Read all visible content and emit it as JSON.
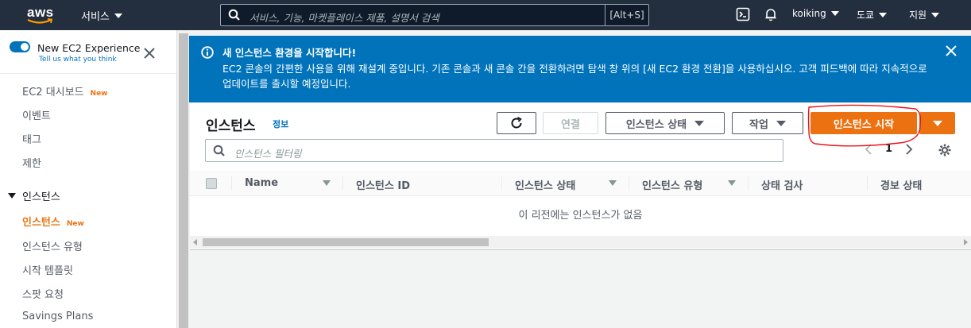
{
  "topnav": {
    "logo_text": "aws",
    "services_label": "서비스",
    "search_placeholder": "서비스, 기능, 마켓플레이스 제품, 설명서 검색",
    "search_shortcut": "[Alt+S]",
    "user": "koiking",
    "region": "도쿄",
    "support": "지원",
    "icons": [
      "terminal-icon",
      "bell-icon"
    ]
  },
  "sidebar": {
    "new_experience": "New EC2 Experience",
    "tell_us": "Tell us what you think",
    "items": [
      {
        "label": "EC2 대시보드",
        "badge": "New"
      },
      {
        "label": "이벤트"
      },
      {
        "label": "태그"
      },
      {
        "label": "제한"
      }
    ],
    "section": "인스턴스",
    "section_items": [
      {
        "label": "인스턴스",
        "badge": "New",
        "active": true
      },
      {
        "label": "인스턴스 유형"
      },
      {
        "label": "시작 템플릿"
      },
      {
        "label": "스팟 요청"
      },
      {
        "label": "Savings Plans"
      }
    ]
  },
  "flash": {
    "title": "새 인스턴스 환경을 시작합니다!",
    "body": "EC2 콘솔의 간편한 사용을 위해 재설계 중입니다. 기존 콘솔과 새 콘솔 간을 전환하려면 탐색 창 위의 [새 EC2 환경 전환]을 사용하십시오. 고객 피드백에 따라 지속적으로 업데이트를 출시할 예정입니다.",
    "color": "#0073bb"
  },
  "instances": {
    "title": "인스턴스",
    "info": "정보",
    "connect": "연결",
    "state": "인스턴스 상태",
    "actions": "작업",
    "launch": "인스턴스 시작",
    "filter_placeholder": "인스턴스 필터링",
    "page": "1",
    "columns": [
      "Name",
      "인스턴스 ID",
      "인스턴스 상태",
      "인스턴스 유형",
      "상태 검사",
      "경보 상태"
    ],
    "empty": "이 리전에는 인스턴스가 없음",
    "accent": "#ec7211"
  }
}
